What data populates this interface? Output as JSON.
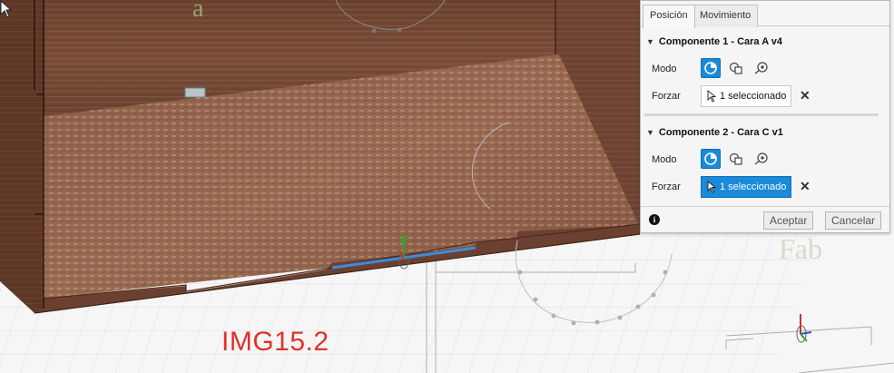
{
  "panel": {
    "tabs": [
      {
        "label": "Posición",
        "active": true
      },
      {
        "label": "Movimiento",
        "active": false
      }
    ],
    "component1": {
      "title": "Componente 1 - Cara A v4",
      "mode_label": "Modo",
      "force_label": "Forzar",
      "selection": "1 seleccionado",
      "selection_active": false
    },
    "component2": {
      "title": "Componente 2 - Cara C v1",
      "mode_label": "Modo",
      "force_label": "Forzar",
      "selection": "1 seleccionado",
      "selection_active": true
    },
    "buttons": {
      "ok": "Aceptar",
      "cancel": "Cancelar"
    },
    "info_glyph": "i",
    "accent_color": "#1a8ad9"
  },
  "overlay": {
    "image_label": "IMG15.2"
  },
  "icons": [
    "snap-origin-icon",
    "between-two-faces-icon",
    "joint-origin-icon",
    "select-arrow-icon",
    "close-icon",
    "info-icon",
    "collapse-caret-icon",
    "mouse-cursor-icon",
    "joint-triad-icon"
  ]
}
